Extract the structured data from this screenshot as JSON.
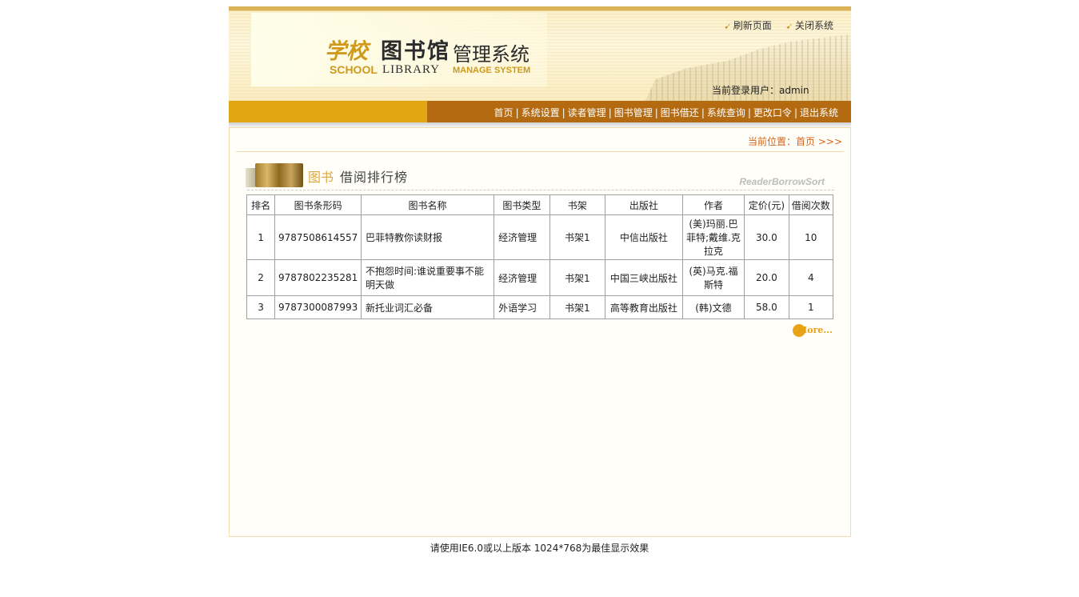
{
  "header": {
    "logo": {
      "school_cn": "学校",
      "library_cn": "图书馆",
      "manage_cn": "管理系统",
      "school_en": "SCHOOL",
      "library_en": "LIBRARY",
      "manage_en": "MANAGE SYSTEM"
    },
    "refresh_label": "刷新页面",
    "close_label": "关闭系统",
    "user_text": "当前登录用户：admin"
  },
  "nav": {
    "items": [
      "首页",
      "系统设置",
      "读者管理",
      "图书管理",
      "图书借还",
      "系统查询",
      "更改口令",
      "退出系统"
    ],
    "separator": "|"
  },
  "location": "当前位置：首页 >>>",
  "section": {
    "title_accent": "图书",
    "title_main": "借阅排行榜",
    "title_en": "ReaderBorrowSort"
  },
  "table": {
    "headers": [
      "排名",
      "图书条形码",
      "图书名称",
      "图书类型",
      "书架",
      "出版社",
      "作者",
      "定价(元)",
      "借阅次数"
    ],
    "rows": [
      [
        "1",
        "9787508614557",
        "巴菲特教你读财报",
        "经济管理",
        "书架1",
        "中信出版社",
        "(美)玛丽.巴菲特;戴维.克拉克",
        "30.0",
        "10"
      ],
      [
        "2",
        "9787802235281",
        "不抱怨时间:谁说重要事不能明天做",
        "经济管理",
        "书架1",
        "中国三峡出版社",
        "(英)马克.福斯特",
        "20.0",
        "4"
      ],
      [
        "3",
        "9787300087993",
        "新托业词汇必备",
        "外语学习",
        "书架1",
        "高等教育出版社",
        "(韩)文德",
        "58.0",
        "1"
      ]
    ]
  },
  "more_label": "More...",
  "footer": "请使用IE6.0或以上版本 1024*768为最佳显示效果",
  "colors": {
    "nav_light": "#e2a612",
    "nav_dark": "#b36a10",
    "location_text": "#d4641a",
    "logo_gold": "#cf9a1c"
  }
}
